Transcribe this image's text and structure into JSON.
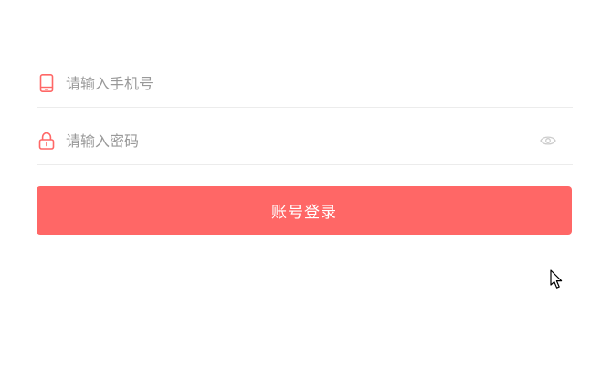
{
  "login_form": {
    "phone": {
      "placeholder": "请输入手机号",
      "value": "",
      "icon": "phone-icon"
    },
    "password": {
      "placeholder": "请输入密码",
      "value": "",
      "icon": "lock-icon",
      "toggle_icon": "eye-icon"
    },
    "submit_label": "账号登录"
  },
  "colors": {
    "accent": "#ff6766",
    "input_text": "#333333",
    "placeholder": "#999999",
    "divider": "#ececec",
    "eye_icon": "#cccccc"
  },
  "cursor_icon": "mouse-pointer-icon"
}
